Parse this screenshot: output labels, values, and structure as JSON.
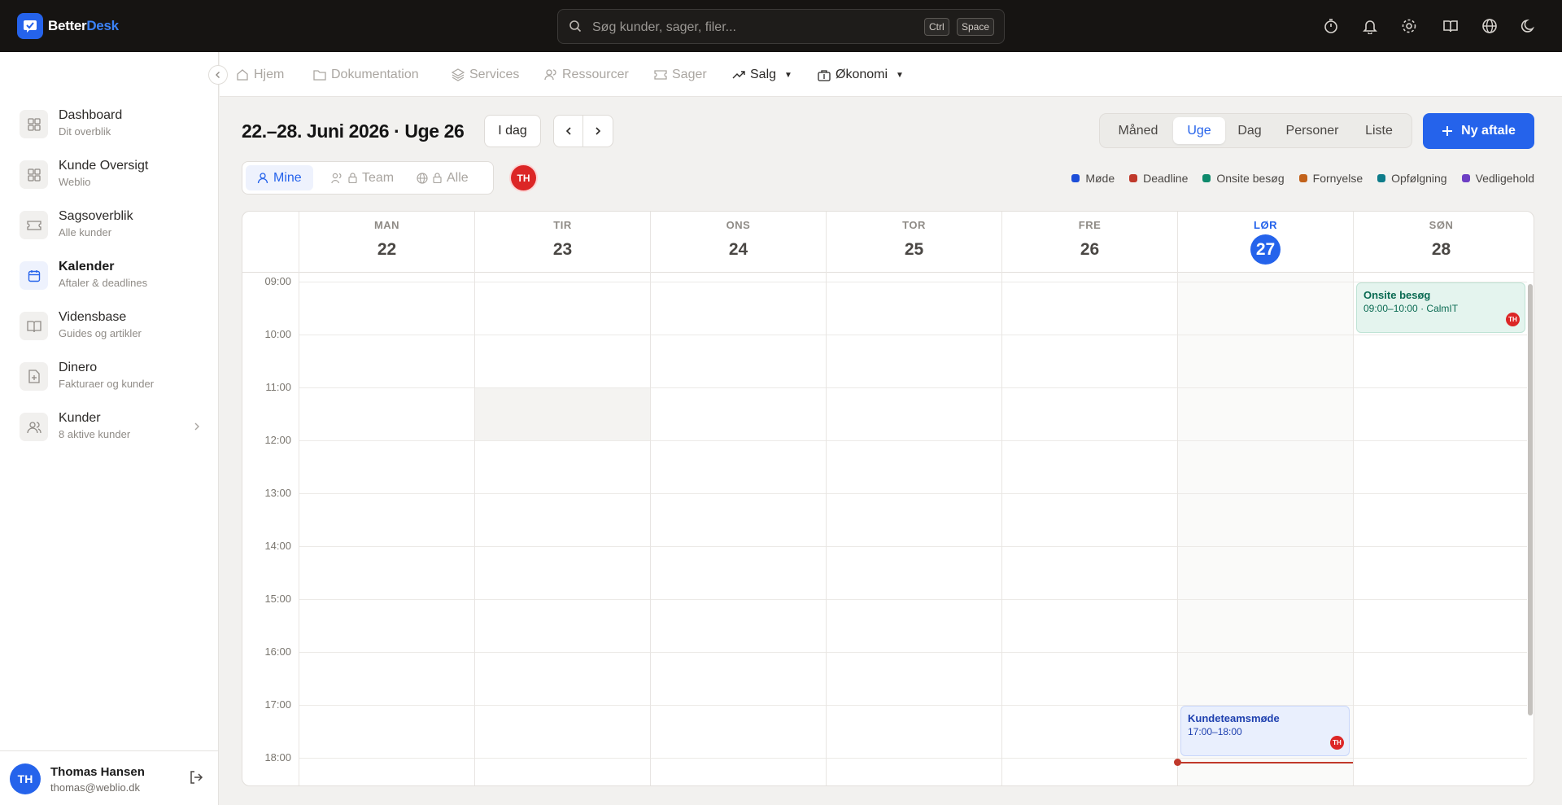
{
  "app": {
    "logo_part1": "Better",
    "logo_part2": "Desk"
  },
  "search": {
    "placeholder": "Søg kunder, sager, filer...",
    "kbd1": "Ctrl",
    "kbd2": "Space"
  },
  "top_icons": [
    "timer-icon",
    "bell-icon",
    "gear-icon",
    "book-icon",
    "globe-icon",
    "moon-icon"
  ],
  "sidebar": {
    "items": [
      {
        "title": "Dashboard",
        "sub": "Dit overblik",
        "icon": "grid-icon"
      },
      {
        "title": "Kunde Oversigt",
        "sub": "Weblio",
        "icon": "grid-icon"
      },
      {
        "title": "Sagsoverblik",
        "sub": "Alle kunder",
        "icon": "ticket-icon"
      },
      {
        "title": "Kalender",
        "sub": "Aftaler & deadlines",
        "icon": "calendar-icon",
        "active": true
      },
      {
        "title": "Vidensbase",
        "sub": "Guides og artikler",
        "icon": "book-icon"
      },
      {
        "title": "Dinero",
        "sub": "Fakturaer og kunder",
        "icon": "invoice-icon"
      },
      {
        "title": "Kunder",
        "sub": "8 aktive kunder",
        "icon": "users-icon"
      }
    ],
    "user": {
      "initials": "TH",
      "name": "Thomas Hansen",
      "email": "thomas@weblio.dk"
    }
  },
  "subnav": {
    "items": [
      {
        "label": "Hjem"
      },
      {
        "label": "Dokumentation"
      },
      {
        "label": "Services"
      },
      {
        "label": "Ressourcer"
      },
      {
        "label": "Sager"
      },
      {
        "label": "Salg"
      },
      {
        "label": "Økonomi"
      }
    ]
  },
  "calendar": {
    "range_title": "22.–28. Juni 2026 · Uge 26",
    "today_button": "I dag",
    "views": [
      "Måned",
      "Uge",
      "Dag",
      "Personer",
      "Liste"
    ],
    "active_view": "Uge",
    "new_button": "Ny aftale",
    "scope": [
      "Mine",
      "Team",
      "Alle"
    ],
    "active_scope": "Mine",
    "user_badge": "TH",
    "legend": [
      {
        "label": "Møde",
        "color": "#1d4ed8"
      },
      {
        "label": "Deadline",
        "color": "#c0392b"
      },
      {
        "label": "Onsite besøg",
        "color": "#0f8a6c"
      },
      {
        "label": "Fornyelse",
        "color": "#c2621a"
      },
      {
        "label": "Opfølgning",
        "color": "#0e7c8a"
      },
      {
        "label": "Vedligehold",
        "color": "#6d3fc4"
      }
    ],
    "days": [
      {
        "dow": "MAN",
        "num": "22"
      },
      {
        "dow": "TIR",
        "num": "23"
      },
      {
        "dow": "ONS",
        "num": "24"
      },
      {
        "dow": "TOR",
        "num": "25"
      },
      {
        "dow": "FRE",
        "num": "26"
      },
      {
        "dow": "LØR",
        "num": "27",
        "today": true
      },
      {
        "dow": "SØN",
        "num": "28"
      }
    ],
    "hours": [
      "09:00",
      "10:00",
      "11:00",
      "12:00",
      "13:00",
      "14:00",
      "15:00",
      "16:00",
      "17:00",
      "18:00"
    ],
    "events": [
      {
        "title": "Onsite besøg",
        "time": "09:00–10:00 · CalmIT",
        "badge": "TH",
        "type": "Onsite besøg",
        "day": "SØN"
      },
      {
        "title": "Kundeteamsmøde",
        "time": "17:00–18:00",
        "badge": "TH",
        "type": "Møde",
        "day": "LØR"
      }
    ]
  }
}
